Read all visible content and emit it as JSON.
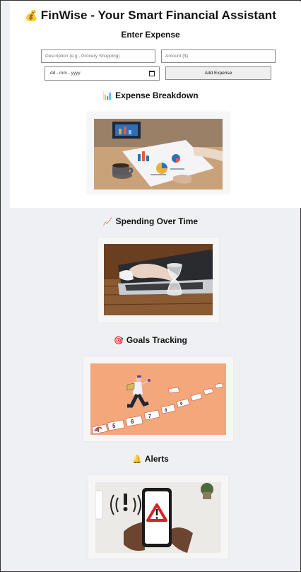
{
  "app": {
    "title": "FinWise - Your Smart Financial Assistant",
    "title_icon": "money-bag-icon"
  },
  "expense_form": {
    "heading": "Enter Expense",
    "description_placeholder": "Description (e.g., Grocery Shopping)",
    "amount_placeholder": "Amount ($)",
    "date_placeholder": "dd - mm - yyyy",
    "add_button_label": "Add Expense"
  },
  "sections": {
    "breakdown": {
      "title": "Expense Breakdown",
      "icon": "bar-chart-icon"
    },
    "spending": {
      "title": "Spending Over Time",
      "icon": "trend-chart-icon"
    },
    "goals": {
      "title": "Goals Tracking",
      "icon": "target-icon"
    },
    "alerts": {
      "title": "Alerts",
      "icon": "bell-icon"
    }
  },
  "colors": {
    "page_background": "#eef0f4",
    "card_background": "#ffffff",
    "goals_image_background": "#f3a77b"
  }
}
